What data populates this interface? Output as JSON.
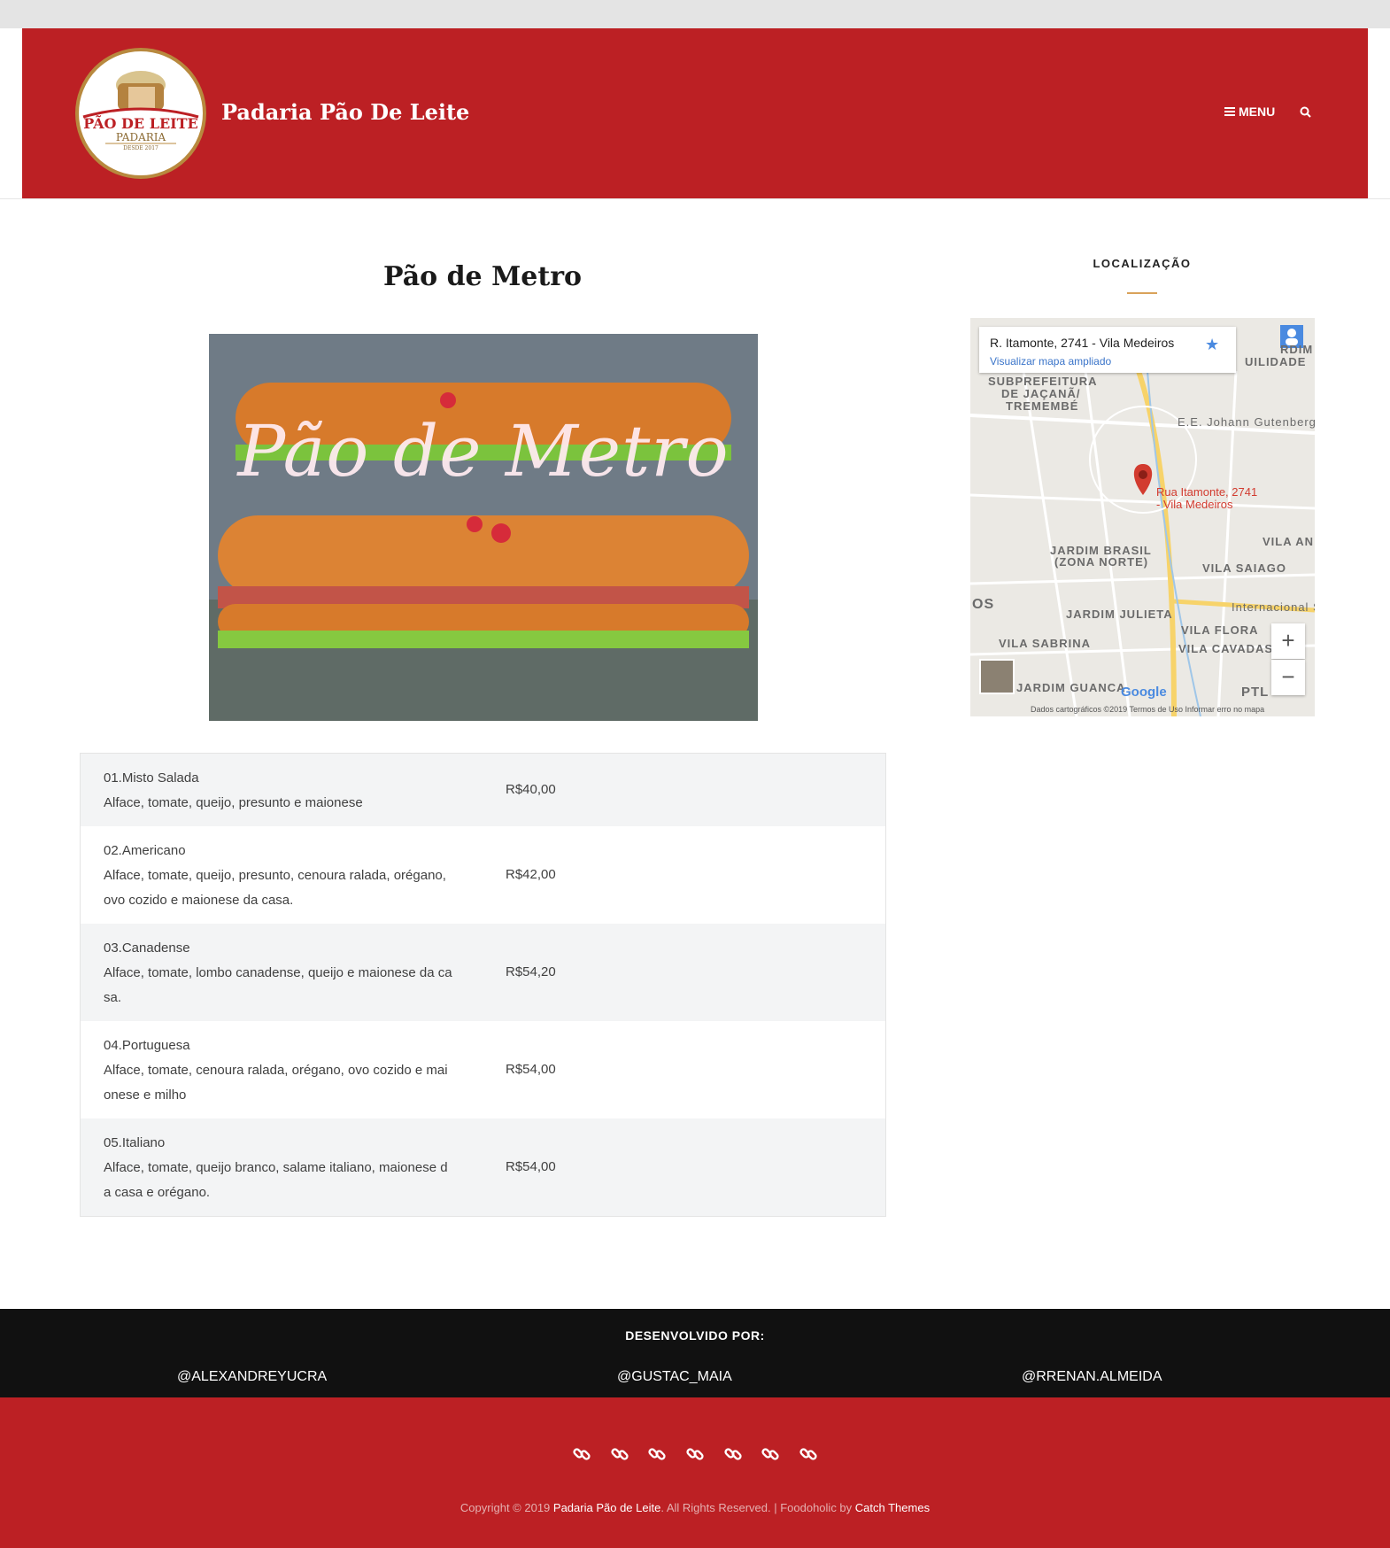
{
  "header": {
    "site_title": "Padaria Pão De Leite",
    "logo": {
      "brand": "PÃO DE LEITE",
      "sub": "PADARIA",
      "since": "DESDE 2017"
    },
    "menu_label": "MENU"
  },
  "main": {
    "title": "Pão de Metro",
    "hero_text": "Pão de Metro",
    "items": [
      {
        "name": "01.Misto Salada",
        "desc": "Alface, tomate, queijo, presunto e maionese",
        "price": "R$40,00"
      },
      {
        "name": "02.Americano",
        "desc": "Alface, tomate, queijo, presunto, cenoura ralada, orégano,",
        "desc2": "ovo cozido e maionese da casa.",
        "price": "R$42,00"
      },
      {
        "name": "03.Canadense",
        "desc": "Alface, tomate, lombo canadense, queijo e maionese da ca",
        "desc2": "sa.",
        "price": "R$54,20"
      },
      {
        "name": "04.Portuguesa",
        "desc": "Alface, tomate, cenoura ralada, orégano, ovo cozido e mai",
        "desc2": "onese e milho",
        "price": "R$54,00"
      },
      {
        "name": "05.Italiano",
        "desc": "Alface, tomate, queijo branco, salame italiano, maionese d",
        "desc2": "a casa e orégano.",
        "price": "R$54,00"
      }
    ]
  },
  "sidebar": {
    "title": "LOCALIZAÇÃO",
    "map": {
      "address": "R. Itamonte, 2741 - Vila Medeiros",
      "link": "Visualizar mapa ampliado",
      "pin_label_1": "Rua Itamonte, 2741",
      "pin_label_2": "- Vila Medeiros",
      "labels": {
        "l1": "SUBPREFEITURA",
        "l2": "DE JAÇANÃ/",
        "l3": "TREMEMBÉ",
        "l4": "E.E. Johann Gutenberg",
        "l5": "JARDIM BRASIL",
        "l6": "(ZONA NORTE)",
        "l7": "VILA SAIAGO",
        "l8": "JARDIM JULIETA",
        "l9": "VILA FLORA",
        "l10": "VILA SABRINA",
        "l11": "VILA CAVADAS",
        "l12": "JARDIM GUANCA",
        "l13": "Internacional Sh",
        "l14": "VILA AN",
        "l15": "RDIM",
        "l16": "UILIDADE",
        "l17": "OS",
        "l18": "PTL"
      },
      "google": "Google",
      "footer": "Dados cartográficos ©2019   Termos de Uso   Informar erro no mapa",
      "zoom_in": "+",
      "zoom_out": "−"
    }
  },
  "developers": {
    "title": "DESENVOLVIDO POR:",
    "handles": [
      "@ALEXANDREYUCRA",
      "@GUSTAC_MAIA",
      "@RRENAN.ALMEIDA"
    ]
  },
  "footer": {
    "copy_prefix": "Copyright © 2019 ",
    "copy_site": "Padaria Pão de Leite",
    "copy_mid": ". All Rights Reserved. | Foodoholic by ",
    "copy_theme": "Catch Themes",
    "social_icons": [
      "link-icon",
      "link-icon",
      "link-icon",
      "link-icon",
      "link-icon",
      "link-icon",
      "link-icon"
    ]
  },
  "colors": {
    "brand_red": "#bc2024",
    "accent_gold": "#d9a25a",
    "dark_band": "#111111"
  }
}
